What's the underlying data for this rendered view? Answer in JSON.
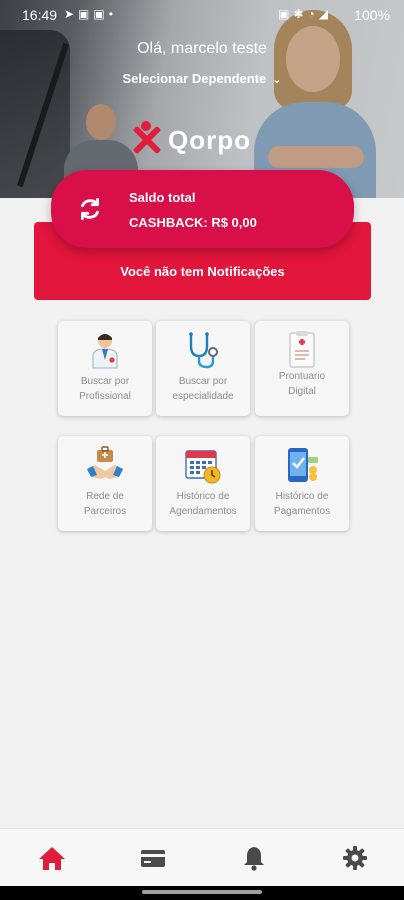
{
  "status_bar": {
    "time": "16:49",
    "battery": "100%"
  },
  "header": {
    "greeting": "Olá, marcelo teste",
    "dependent_selector": "Selecionar Dependente",
    "logo_text": "Qorpo"
  },
  "balance": {
    "title": "Saldo total",
    "cashback": "CASHBACK: R$ 0,00"
  },
  "notifications": {
    "message": "Você não tem Notificações"
  },
  "tiles": [
    {
      "line1": "Buscar por",
      "line2": "Profissional",
      "icon": "doctor-icon"
    },
    {
      "line1": "Buscar por",
      "line2": "especialidade",
      "icon": "stethoscope-icon"
    },
    {
      "line1": "Prontuario",
      "line2": "Digital",
      "icon": "medical-record-icon"
    },
    {
      "line1": "Rede de",
      "line2": "Parceiros",
      "icon": "handshake-icon"
    },
    {
      "line1": "Histórico de",
      "line2": "Agendamentos",
      "icon": "calendar-clock-icon"
    },
    {
      "line1": "Histórico de",
      "line2": "Pagamentos",
      "icon": "phone-payment-icon"
    }
  ],
  "bottom_nav": [
    {
      "icon": "home-icon",
      "active": true
    },
    {
      "icon": "card-icon",
      "active": false
    },
    {
      "icon": "bell-icon",
      "active": false
    },
    {
      "icon": "gear-icon",
      "active": false
    }
  ],
  "colors": {
    "primary": "#d80f49",
    "notice": "#e2153c",
    "active_nav": "#e11d3c",
    "inactive_nav": "#4a4a4a"
  }
}
